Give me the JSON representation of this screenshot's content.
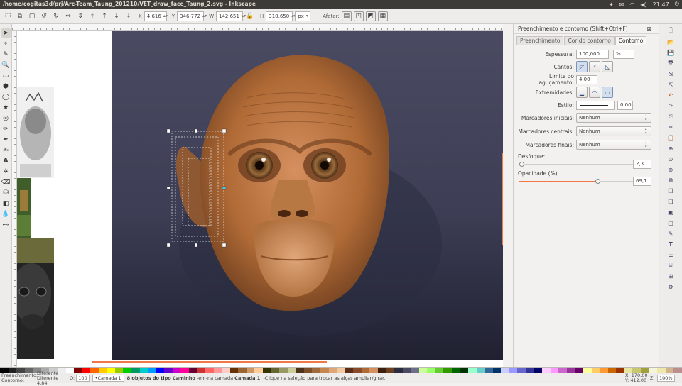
{
  "window": {
    "title": "/home/cogitas3d/prj/Arc-Team_Taung_201210/VET_draw_face_Taung_2.svg - Inkscape",
    "clock": "21:47"
  },
  "toolbar": {
    "x_label": "X",
    "x_value": "4,616",
    "y_label": "Y",
    "y_value": "346,772",
    "w_label": "W",
    "w_value": "142,651",
    "h_label": "H",
    "h_value": "310,650",
    "unit": "px",
    "affect_label": "Afetar:"
  },
  "panel": {
    "title": "Preenchimento e contorno (Shift+Ctrl+F)",
    "tabs": [
      "Preenchimento",
      "Cor do contorno",
      "Contorno"
    ],
    "active_tab": 2,
    "width_label": "Espessura:",
    "width_value": "100,000",
    "width_unit": "%",
    "corners_label": "Cantos:",
    "miter_label": "Limite do aguçamento:",
    "miter_value": "4,00",
    "caps_label": "Extremidades:",
    "style_label": "Estilo:",
    "style_value": "0,00",
    "start_markers_label": "Marcadores iniciais:",
    "start_markers_value": "Nenhum",
    "mid_markers_label": "Marcadores centrais:",
    "mid_markers_value": "Nenhum",
    "end_markers_label": "Marcadores finais:",
    "end_markers_value": "Nenhum",
    "blur_label": "Desfoque:",
    "blur_value": "2,3",
    "blur_fraction": 0.023,
    "opacity_label": "Opacidade (%)",
    "opacity_value": "69,1",
    "opacity_fraction": 0.691
  },
  "status": {
    "fill_label": "Preenchimento:",
    "fill_value": "Diferente",
    "stroke_label": "Contorno:",
    "stroke_value": "Diferente 4,84",
    "opacity_label": "O:",
    "opacity_value": "100",
    "layer": "•Camada 1",
    "message_prefix": "8 objetos do tipo ",
    "message_type": "Caminho",
    "message_mid": " -em-na camada ",
    "message_layer": "Camada 1",
    "message_suffix": ". -Clique na seleção para trocar as alças ampliar/girar.",
    "x_label": "X:",
    "x_value": "170,00",
    "y_label": "Y:",
    "y_value": "412,00",
    "zoom_label": "Z:",
    "zoom_value": "100%"
  },
  "colors": {
    "accent": "#f07746",
    "background": "#3d3e55",
    "skin": "#b8743f"
  }
}
